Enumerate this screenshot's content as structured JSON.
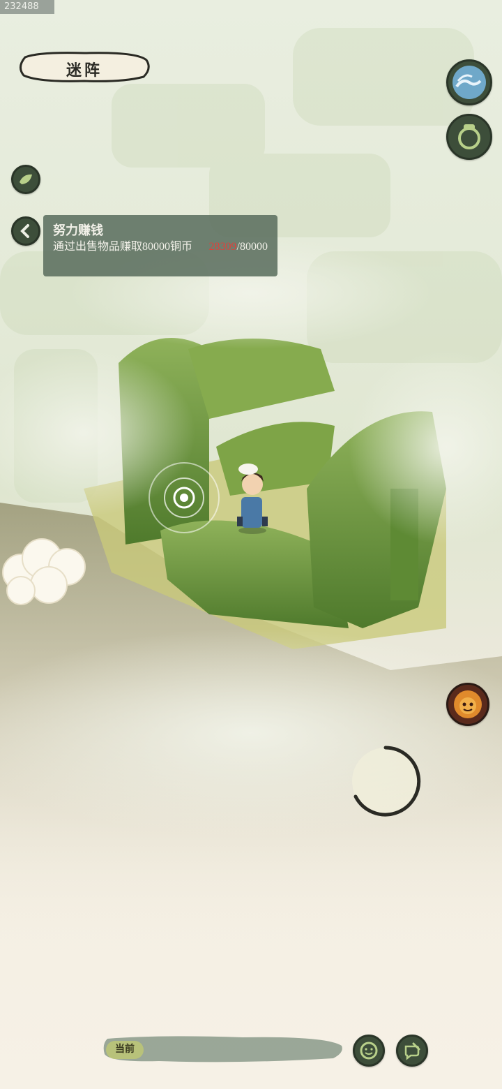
{
  "debug_id": "232488",
  "title": "迷阵",
  "quest": {
    "title": "努力赚钱",
    "description": "通过出售物品赚取80000铜币",
    "progress_current": "28309",
    "progress_separator": "/",
    "progress_total": "80000"
  },
  "bottom_bar": {
    "current_label": "当前"
  },
  "icons": {
    "top_right_1": "wave-icon",
    "top_right_2": "jar-icon",
    "left_1": "leaf-icon",
    "collapse": "chevron-left-icon",
    "boss": "demon-face-icon",
    "emote": "smiley-icon",
    "chat": "pen-chat-icon",
    "joystick": "joystick-ring"
  },
  "colors": {
    "button_dark": "#3d4e3a",
    "quest_bg": "#5c7060",
    "progress_red": "#e0403a",
    "hedge_green": "#6f9a3c"
  }
}
